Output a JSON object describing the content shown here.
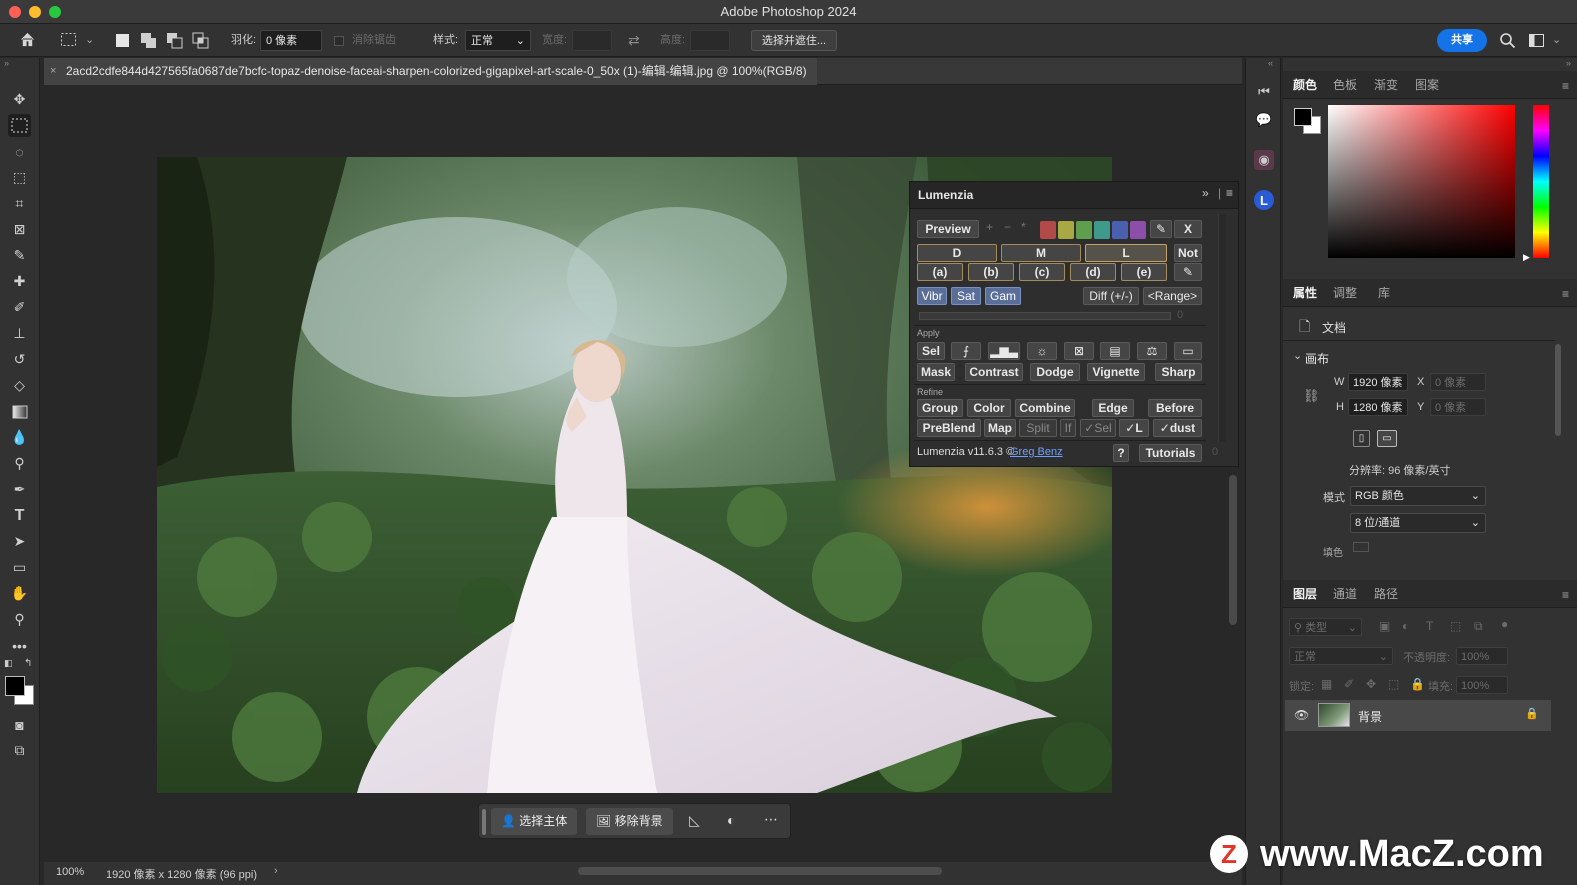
{
  "app": {
    "title": "Adobe Photoshop 2024"
  },
  "options": {
    "feather_label": "羽化:",
    "feather_value": "0 像素",
    "antialias_label": "消除锯齿",
    "style_label": "样式:",
    "style_value": "正常",
    "width_label": "宽度:",
    "height_label": "高度:",
    "select_mask_label": "选择并遮住...",
    "share_label": "共享"
  },
  "document": {
    "tab_title": "2acd2cdfe844d427565fa0687de7bcfc-topaz-denoise-faceai-sharpen-colorized-gigapixel-art-scale-0_50x (1)-编辑-编辑.jpg @ 100%(RGB/8)"
  },
  "context_bar": {
    "select_subject": "选择主体",
    "remove_bg": "移除背景"
  },
  "status": {
    "zoom": "100%",
    "info": "1920 像素 x 1280 像素 (96 ppi)"
  },
  "color_panel": {
    "tabs": [
      "颜色",
      "色板",
      "渐变",
      "图案"
    ]
  },
  "properties_panel": {
    "tabs": [
      "属性",
      "调整",
      "库"
    ],
    "doc_label": "文档",
    "canvas_label": "画布",
    "w_label": "W",
    "w_value": "1920 像素",
    "h_label": "H",
    "h_value": "1280 像素",
    "x_label": "X",
    "x_value": "0 像素",
    "y_label": "Y",
    "y_value": "0 像素",
    "resolution": "分辨率: 96 像素/英寸",
    "mode_label": "模式",
    "mode_value": "RGB 颜色",
    "depth_value": "8 位/通道",
    "fill_label": "填色"
  },
  "layers_panel": {
    "tabs": [
      "图层",
      "通道",
      "路径"
    ],
    "filter_placeholder": "类型",
    "blend_mode": "正常",
    "opacity_label": "不透明度:",
    "opacity_value": "100%",
    "lock_label": "锁定:",
    "fill_label": "填充:",
    "fill_value": "100%",
    "layers": [
      {
        "name": "背景"
      }
    ]
  },
  "lumenzia": {
    "title": "Lumenzia",
    "preview": "Preview",
    "close": "X",
    "zones": [
      "D",
      "M",
      "L"
    ],
    "not": "Not",
    "levels": [
      "(a)",
      "(b)",
      "(c)",
      "(d)",
      "(e)"
    ],
    "vibr": "Vibr",
    "sat": "Sat",
    "gam": "Gam",
    "diff": "Diff (+/-)",
    "range": "<Range>",
    "slider_value": "0",
    "apply_label": "Apply",
    "sel": "Sel",
    "apply_row2": [
      "Mask",
      "Contrast",
      "Dodge",
      "Vignette",
      "Sharp"
    ],
    "refine_label": "Refine",
    "refine_row1": [
      "Group",
      "Color",
      "Combine",
      "Edge",
      "Before"
    ],
    "refine_row2": [
      "PreBlend",
      "Map",
      "Split",
      "If",
      "✓Sel",
      "✓L",
      "✓dust"
    ],
    "version": "Lumenzia v11.6.3 ©",
    "author": "Greg Benz",
    "help": "?",
    "tutorials": "Tutorials",
    "footer_zero": "0",
    "swatch_colors": [
      "#b24a4a",
      "#a8a845",
      "#5e9e4d",
      "#3f9a8c",
      "#4a5fae",
      "#8c4fa9"
    ]
  },
  "watermark": {
    "text": "www.MacZ.com",
    "logo_letter": "Z"
  }
}
